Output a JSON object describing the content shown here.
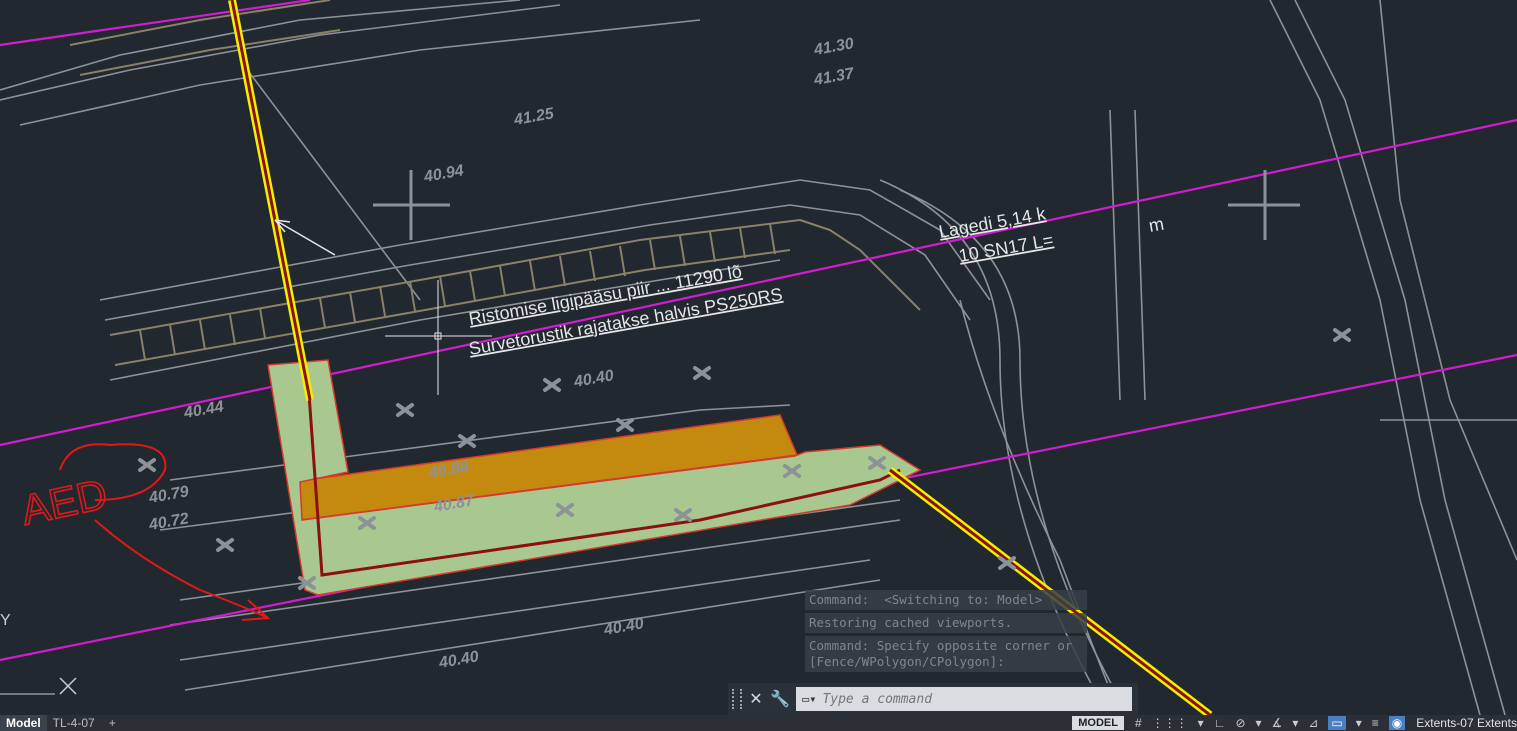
{
  "drawing": {
    "annotations": {
      "line1": "Ristomise ligipääsu piir ... 11290 lõ",
      "line2": "Survetorustik rajatakse halvis PS250RS",
      "line3_left": "Lagedi 5,14 k",
      "line3_right": "10 SN17 L=",
      "line3_unit": "m",
      "elev_a": "40.94",
      "elev_b": "40.40",
      "elev_c": "40.87",
      "elev_d": "40.88",
      "elev_e": "40.40",
      "elev_f": "41.30",
      "elev_g": "41.37",
      "elev_h": "41.25",
      "elev_i": "40.79",
      "elev_j": "40.72",
      "elev_k": "40.44",
      "elev_l": "40.40",
      "markup": "AED",
      "ucs_y": "Y"
    },
    "colors": {
      "background": "#212830",
      "geometry_gray": "#8d9298",
      "magenta": "#d21cd2",
      "road_yellow": "#f2f000",
      "pipe_red": "#8b1010",
      "lawn_green": "#a8c890",
      "paving_orange": "#c48a10",
      "markup_red": "#e01818"
    }
  },
  "command_history": [
    "Command:  <Switching to: Model>",
    "Restoring cached viewports.",
    "Command: Specify opposite corner or",
    "[Fence/WPolygon/CPolygon]:"
  ],
  "command_line": {
    "close_icon": "close-icon",
    "customize_icon": "wrench-icon",
    "prompt_glyph": "▭▾",
    "placeholder": "Type a command"
  },
  "status_bar": {
    "tabs": [
      "Model",
      "TL-4-07"
    ],
    "add_tab": "+",
    "space_label": "MODEL",
    "icons": [
      "#",
      "⋮⋮⋮",
      "▾",
      "∟",
      "⊘",
      "▾",
      "∡",
      "▾",
      "⊿",
      "▭",
      "▾",
      "≡",
      "◉"
    ],
    "extent_label": "Extents-07 Extents"
  }
}
